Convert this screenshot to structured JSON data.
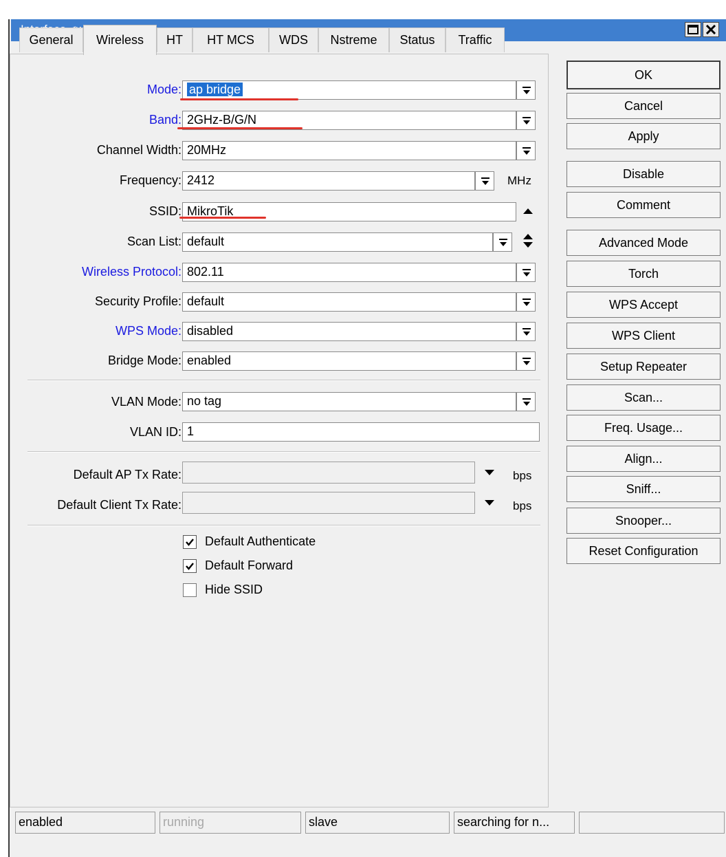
{
  "window": {
    "title": "Interface <wlan1>"
  },
  "tabs": [
    "General",
    "Wireless",
    "HT",
    "HT MCS",
    "WDS",
    "Nstreme",
    "Status",
    "Traffic"
  ],
  "active_tab": "Wireless",
  "form": {
    "mode": {
      "label": "Mode:",
      "value": "ap bridge"
    },
    "band": {
      "label": "Band:",
      "value": "2GHz-B/G/N"
    },
    "channel_width": {
      "label": "Channel Width:",
      "value": "20MHz"
    },
    "frequency": {
      "label": "Frequency:",
      "value": "2412",
      "unit": "MHz"
    },
    "ssid": {
      "label": "SSID:",
      "value": "MikroTik"
    },
    "scan_list": {
      "label": "Scan List:",
      "value": "default"
    },
    "wireless_protocol": {
      "label": "Wireless Protocol:",
      "value": "802.11"
    },
    "security_profile": {
      "label": "Security Profile:",
      "value": "default"
    },
    "wps_mode": {
      "label": "WPS Mode:",
      "value": "disabled"
    },
    "bridge_mode": {
      "label": "Bridge Mode:",
      "value": "enabled"
    },
    "vlan_mode": {
      "label": "VLAN Mode:",
      "value": "no tag"
    },
    "vlan_id": {
      "label": "VLAN ID:",
      "value": "1"
    },
    "default_ap_tx_rate": {
      "label": "Default AP Tx Rate:",
      "value": "",
      "unit": "bps"
    },
    "default_client_tx_rate": {
      "label": "Default Client Tx Rate:",
      "value": "",
      "unit": "bps"
    }
  },
  "checkboxes": [
    {
      "label": "Default Authenticate",
      "checked": true
    },
    {
      "label": "Default Forward",
      "checked": true
    },
    {
      "label": "Hide SSID",
      "checked": false
    }
  ],
  "buttons": [
    "OK",
    "Cancel",
    "Apply",
    "Disable",
    "Comment",
    "Advanced Mode",
    "Torch",
    "WPS Accept",
    "WPS Client",
    "Setup Repeater",
    "Scan...",
    "Freq. Usage...",
    "Align...",
    "Sniff...",
    "Snooper...",
    "Reset Configuration"
  ],
  "status": [
    "enabled",
    "running",
    "slave",
    "searching for n...",
    ""
  ],
  "colors": {
    "title_bar": "#3f7fcf",
    "blue_label": "#1a1ae0",
    "selection": "#1e6fd1",
    "annotation_underline": "#e0332b"
  }
}
